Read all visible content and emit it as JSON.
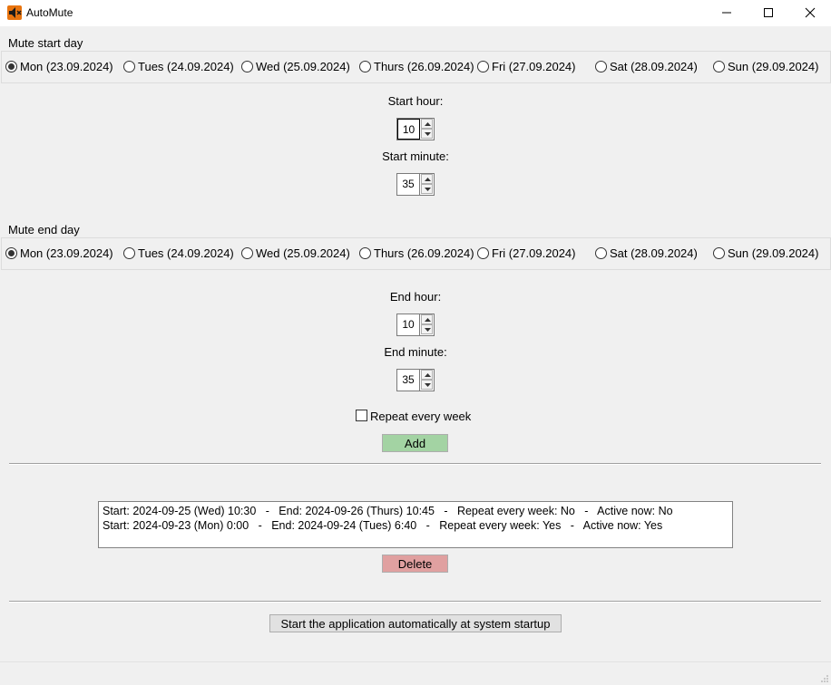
{
  "window": {
    "title": "AutoMute",
    "icon": "speaker-mute-icon",
    "controls": [
      "minimize-icon",
      "maximize-icon",
      "close-icon"
    ]
  },
  "start_day": {
    "label": "Mute start day",
    "options": [
      {
        "label": "Mon (23.09.2024)",
        "selected": true
      },
      {
        "label": "Tues (24.09.2024)",
        "selected": false
      },
      {
        "label": "Wed (25.09.2024)",
        "selected": false
      },
      {
        "label": "Thurs (26.09.2024)",
        "selected": false
      },
      {
        "label": "Fri (27.09.2024)",
        "selected": false
      },
      {
        "label": "Sat (28.09.2024)",
        "selected": false
      },
      {
        "label": "Sun (29.09.2024)",
        "selected": false
      }
    ]
  },
  "start_hour": {
    "label": "Start hour:",
    "value": "10"
  },
  "start_minute": {
    "label": "Start minute:",
    "value": "35"
  },
  "end_day": {
    "label": "Mute end day",
    "options": [
      {
        "label": "Mon (23.09.2024)",
        "selected": true
      },
      {
        "label": "Tues (24.09.2024)",
        "selected": false
      },
      {
        "label": "Wed (25.09.2024)",
        "selected": false
      },
      {
        "label": "Thurs (26.09.2024)",
        "selected": false
      },
      {
        "label": "Fri (27.09.2024)",
        "selected": false
      },
      {
        "label": "Sat (28.09.2024)",
        "selected": false
      },
      {
        "label": "Sun (29.09.2024)",
        "selected": false
      }
    ]
  },
  "end_hour": {
    "label": "End hour:",
    "value": "10"
  },
  "end_minute": {
    "label": "End minute:",
    "value": "35"
  },
  "repeat": {
    "label": "Repeat every week",
    "checked": false
  },
  "add_button": {
    "label": "Add",
    "color": "#a3d3a3"
  },
  "schedule_list": [
    "Start: 2024-09-25 (Wed) 10:30   -   End: 2024-09-26 (Thurs) 10:45   -   Repeat every week: No   -   Active now: No",
    "Start: 2024-09-23 (Mon) 0:00   -   End: 2024-09-24 (Tues) 6:40   -   Repeat every week: Yes   -   Active now: Yes"
  ],
  "delete_button": {
    "label": "Delete",
    "color": "#e0a0a0"
  },
  "startup_button": {
    "label": "Start the application automatically at system startup"
  }
}
